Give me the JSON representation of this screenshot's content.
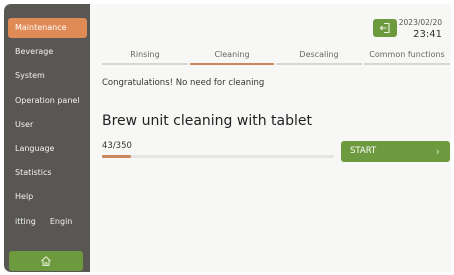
{
  "sidebar": {
    "items": [
      {
        "label": "Maintenance",
        "active": true
      },
      {
        "label": "Beverage"
      },
      {
        "label": "System"
      },
      {
        "label": "Operation panel"
      },
      {
        "label": "User"
      },
      {
        "label": "Language"
      },
      {
        "label": "Statistics"
      },
      {
        "label": "Help"
      },
      {
        "label": "itting",
        "extra": "Engin"
      }
    ],
    "home_icon": "home-icon"
  },
  "header": {
    "logout_icon": "logout-icon",
    "date": "2023/02/20",
    "time": "23:41"
  },
  "tabs": [
    {
      "label": "Rinsing"
    },
    {
      "label": "Cleaning",
      "active": true
    },
    {
      "label": "Descaling"
    },
    {
      "label": "Common functions"
    }
  ],
  "main": {
    "message": "Congratulations! No need for cleaning",
    "title": "Brew unit cleaning with tablet",
    "counter": "43/350",
    "progress": 0.123,
    "start_label": "START",
    "start_icon": "chevron-right-icon"
  },
  "colors": {
    "accent_orange": "#e08a55",
    "accent_green": "#6e9a3f",
    "sidebar_bg": "#595754"
  }
}
